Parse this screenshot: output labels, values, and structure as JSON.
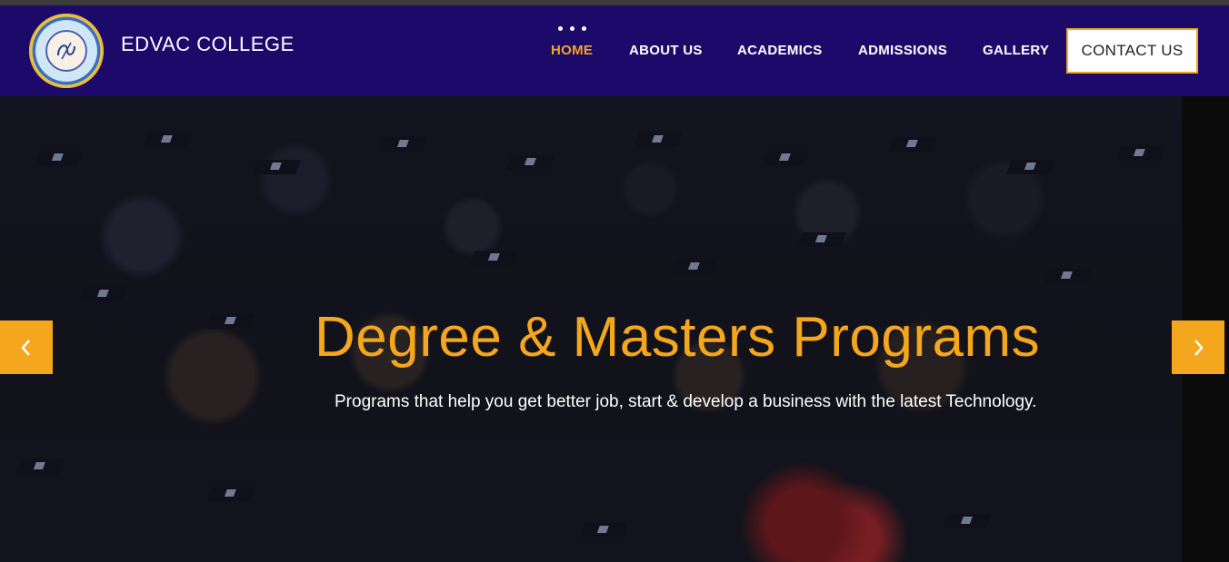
{
  "brand": {
    "name": "EDVAC COLLEGE",
    "logo_icon": "college-seal-logo"
  },
  "nav": {
    "items": [
      {
        "label": "HOME",
        "active": true
      },
      {
        "label": "ABOUT US",
        "active": false
      },
      {
        "label": "ACADEMICS",
        "active": false
      },
      {
        "label": "ADMISSIONS",
        "active": false
      },
      {
        "label": "GALLERY",
        "active": false
      }
    ],
    "contact_label": "CONTACT US",
    "active_indicator_icon": "three-dots-icon"
  },
  "hero": {
    "title": "Degree & Masters Programs",
    "subtitle": "Programs that help you get better job, start & develop a business with the latest Technology.",
    "image_description_icon": "graduation-crowd-photo",
    "prev_icon": "chevron-left-icon",
    "next_icon": "chevron-right-icon"
  },
  "colors": {
    "nav_background": "#1c0a6b",
    "accent": "#f4a61c",
    "text_light": "#ffffff"
  }
}
